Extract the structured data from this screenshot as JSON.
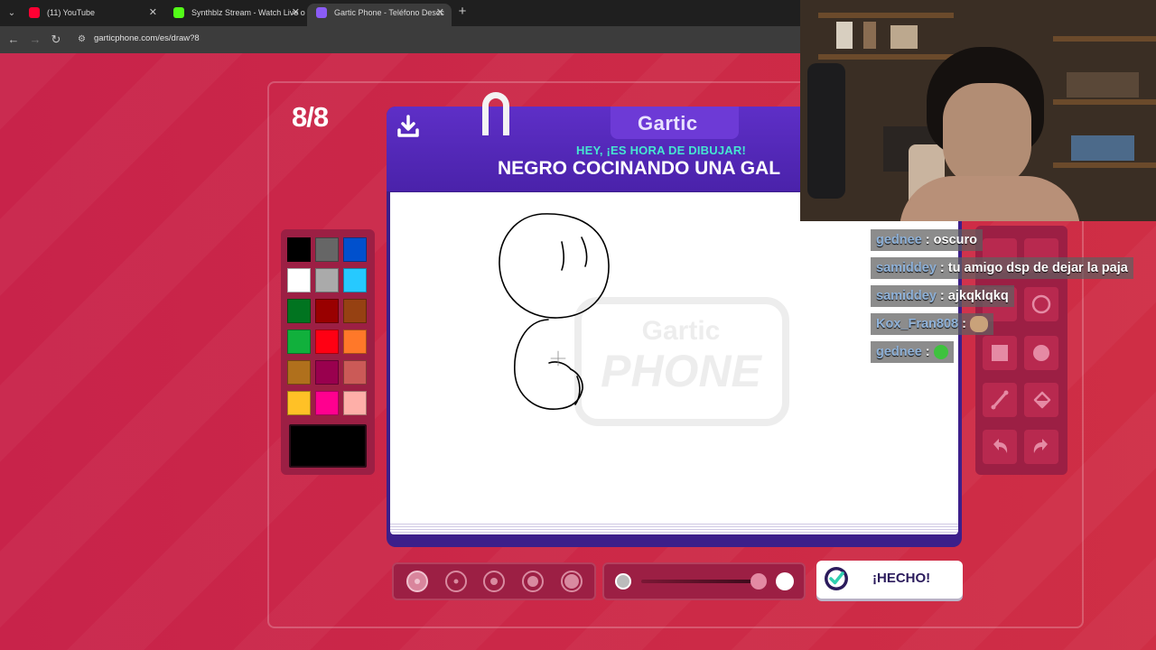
{
  "browser": {
    "tabs": [
      {
        "title": "(11) YouTube",
        "favicon_color": "#ff0033"
      },
      {
        "title": "Synthblz Stream - Watch Live o",
        "favicon_color": "#53fc18"
      },
      {
        "title": "Gartic Phone - Teléfono Descc",
        "favicon_color": "#8b5cf6"
      }
    ],
    "url": "garticphone.com/es/draw?8"
  },
  "game": {
    "round": "8/8",
    "logo": "Gartic",
    "watermark": {
      "line1": "Gartic",
      "line2": "PHONE"
    },
    "prompt_label": "HEY, ¡ES HORA DE DIBUJAR!",
    "prompt_text": "NEGRO COCINANDO UNA GAL",
    "palette": [
      "#000000",
      "#666666",
      "#0050cd",
      "#ffffff",
      "#aaaaaa",
      "#26c9ff",
      "#017420",
      "#990000",
      "#964112",
      "#11b03c",
      "#ff0013",
      "#ff7829",
      "#b0701c",
      "#99004e",
      "#cb5a57",
      "#ffc126",
      "#ff008f",
      "#feafa8"
    ],
    "selected_color": "#000000",
    "brush_sizes": 5,
    "opacity_percent": 100,
    "done_label": "¡HECHO!"
  },
  "chat": [
    {
      "user": "gednee",
      "message": "oscuro"
    },
    {
      "user": "samiddey",
      "message": "tu amigo dsp de dejar la paja"
    },
    {
      "user": "samiddey",
      "message": "ajkqklqkq"
    },
    {
      "user": "Kox_Fran808",
      "message": ""
    },
    {
      "user": "gednee",
      "message": ""
    }
  ],
  "colors": {
    "accent_purple": "#4a22aa",
    "background_red": "#c8244a",
    "chat_user": "#8fb2d9",
    "prompt_teal": "#46e6d0"
  }
}
